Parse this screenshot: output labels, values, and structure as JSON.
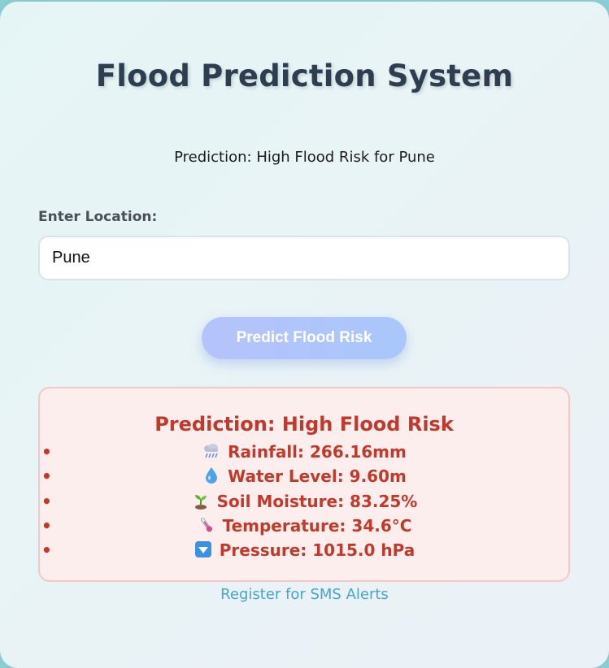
{
  "page": {
    "title": "Flood Prediction System",
    "status_text": "Prediction: High Flood Risk for Pune"
  },
  "form": {
    "location_label": "Enter Location:",
    "location_value": "Pune",
    "predict_button_label": "Predict Flood Risk"
  },
  "result": {
    "heading": "Prediction: High Flood Risk",
    "items": [
      {
        "icon": "rain-cloud-icon",
        "text": "Rainfall: 266.16mm"
      },
      {
        "icon": "water-drop-icon",
        "text": "Water Level: 9.60m"
      },
      {
        "icon": "seedling-icon",
        "text": "Soil Moisture: 83.25%"
      },
      {
        "icon": "thermometer-icon",
        "text": "Temperature: 34.6°C"
      },
      {
        "icon": "down-arrow-icon",
        "text": "Pressure: 1015.0 hPa"
      }
    ]
  },
  "footer": {
    "sms_link": "Register for SMS Alerts"
  },
  "colors": {
    "title": "#2c3e50",
    "risk_red": "#c0392b",
    "button_start": "#b5c3fb",
    "button_end": "#a9c7fb",
    "link": "#4aa3c9",
    "result_bg": "#fdeeee",
    "result_border": "#f7c6c6"
  }
}
